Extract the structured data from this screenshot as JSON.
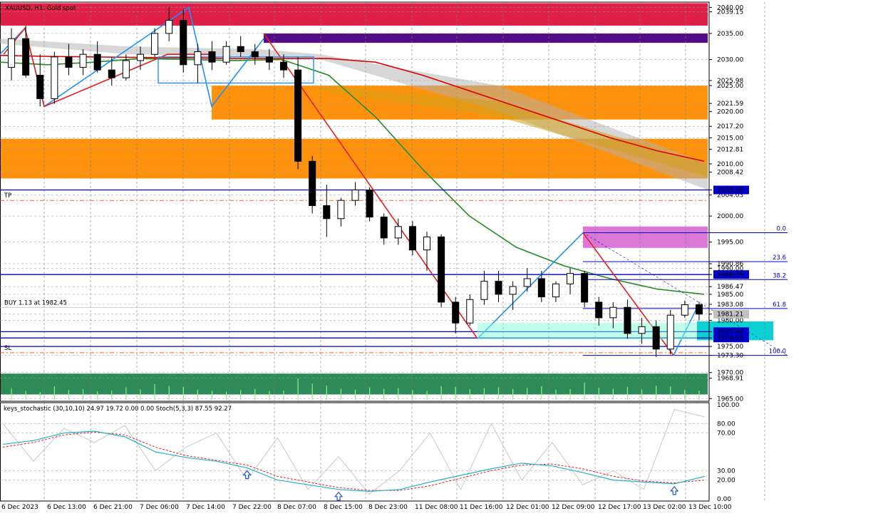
{
  "chart_data": {
    "type": "candlestick",
    "title": "XAUUSD, H1: Gold spot",
    "symbol": "XAUUSD",
    "timeframe": "H1",
    "description": "Gold spot",
    "ylim": [
      1964.5,
      2041.0
    ],
    "y_ticks": [
      "2040.00",
      "2039.15",
      "2035.00",
      "2030.00",
      "2025.98",
      "2025.00",
      "2021.59",
      "2020.00",
      "2017.20",
      "2015.00",
      "2012.81",
      "2010.00",
      "2008.42",
      "2005.00",
      "2004.03",
      "2000.00",
      "1995.00",
      "1990.86",
      "1990.00",
      "1988.79",
      "1986.47",
      "1985.00",
      "1983.08",
      "1981.21",
      "1980.00",
      "1977.84",
      "1976.63",
      "1975.00",
      "1973.30",
      "1970.00",
      "1968.91",
      "1965.00"
    ],
    "x_ticks": [
      "6 Dec 2023",
      "6 Dec 13:00",
      "6 Dec 21:00",
      "7 Dec 06:00",
      "7 Dec 14:00",
      "7 Dec 22:00",
      "8 Dec 07:00",
      "8 Dec 15:00",
      "8 Dec 23:00",
      "11 Dec 08:00",
      "11 Dec 16:00",
      "12 Dec 01:00",
      "12 Dec 09:00",
      "12 Dec 17:00",
      "13 Dec 02:00",
      "13 Dec 10:00"
    ],
    "price_labels": [
      {
        "value": 1981.21,
        "color": "#c0c0c0"
      },
      {
        "value": 1977.84,
        "color": "#0000cc"
      },
      {
        "value": 1976.63,
        "color": "#0000cc"
      },
      {
        "value": 1988.79,
        "color": "#0000cc"
      },
      {
        "value": 2005.0,
        "color": "#0000cc"
      }
    ],
    "zones": [
      {
        "name": "red-supply-zone",
        "y1": 2036.5,
        "y2": 2040.8,
        "color": "#dc143c"
      },
      {
        "name": "purple-zone",
        "y1": 2033.2,
        "y2": 2035.0,
        "color": "#4b0082"
      },
      {
        "name": "orange-zone-upper",
        "y1": 2018.5,
        "y2": 2025.0,
        "color": "#ff8c00"
      },
      {
        "name": "orange-zone-lower",
        "y1": 2007.2,
        "y2": 2014.8,
        "color": "#ff8c00"
      },
      {
        "name": "magenta-zone",
        "y1": 1993.9,
        "y2": 1998.0,
        "color": "#da70d6"
      },
      {
        "name": "cyan-zone",
        "y1": 1976.2,
        "y2": 1979.8,
        "color": "#00ced1"
      },
      {
        "name": "volume-band",
        "y1": 1965.8,
        "y2": 1969.8,
        "color": "#2e8b57"
      }
    ],
    "horizontal_levels": [
      {
        "label": "TP",
        "value": 2003.0,
        "style": "dashdot",
        "color": "#ff4500"
      },
      {
        "label": "SL",
        "value": 1973.8,
        "style": "dashdot",
        "color": "#ff4500"
      },
      {
        "label": "BUY 1.13 at 1982.45",
        "value": 1982.45,
        "style": "solid",
        "color": "#c0c0c0"
      }
    ],
    "fibonacci": {
      "high": 1996.8,
      "low": 1973.3,
      "levels": [
        {
          "label": "0.0",
          "value": 1996.8
        },
        {
          "label": "23.6",
          "value": 1991.25
        },
        {
          "label": "38.2",
          "value": 1987.82
        },
        {
          "label": "61.8",
          "value": 1982.28
        },
        {
          "label": "100.0",
          "value": 1973.3
        }
      ]
    },
    "series": [
      {
        "name": "",
        "color": "#dd0000",
        "values": [
          2030.8,
          2030.6,
          2030.5,
          2030.4,
          2030.3,
          2030.2,
          2030.2,
          2030.2,
          2029.5,
          2027.0,
          2024.0,
          2021.0,
          2018.0,
          2015.0,
          2012.5,
          2010.5
        ]
      },
      {
        "name": "",
        "color": "#228b22",
        "values": [
          2029.5,
          2029.0,
          2029.5,
          2030.2,
          2030.0,
          2029.8,
          2030.0,
          2027.0,
          2019.0,
          2009.0,
          2000.0,
          1994.0,
          1990.5,
          1988.0,
          1986.0,
          1985.0
        ]
      }
    ],
    "candles": [
      [
        2028.5,
        2036.0,
        2026.0,
        2034.0
      ],
      [
        2034.0,
        2036.5,
        2026.5,
        2027.0
      ],
      [
        2027.0,
        2031.0,
        2021.0,
        2022.5
      ],
      [
        2022.5,
        2031.5,
        2021.5,
        2030.5
      ],
      [
        2030.5,
        2033.0,
        2027.0,
        2028.5
      ],
      [
        2028.5,
        2032.0,
        2027.0,
        2031.0
      ],
      [
        2031.0,
        2033.5,
        2027.5,
        2028.0
      ],
      [
        2028.0,
        2030.5,
        2025.0,
        2026.5
      ],
      [
        2026.5,
        2031.0,
        2026.0,
        2029.8
      ],
      [
        2029.8,
        2032.5,
        2028.0,
        2031.0
      ],
      [
        2031.0,
        2036.0,
        2030.5,
        2035.0
      ],
      [
        2035.0,
        2040.0,
        2033.5,
        2037.5
      ],
      [
        2037.5,
        2039.5,
        2027.5,
        2029.0
      ],
      [
        2029.0,
        2033.0,
        2025.5,
        2031.5
      ],
      [
        2031.5,
        2033.5,
        2028.0,
        2029.5
      ],
      [
        2029.5,
        2033.5,
        2029.0,
        2032.5
      ],
      [
        2032.5,
        2034.5,
        2030.5,
        2031.5
      ],
      [
        2031.5,
        2033.0,
        2029.0,
        2030.5
      ],
      [
        2030.5,
        2032.0,
        2028.0,
        2029.5
      ],
      [
        2029.5,
        2031.0,
        2026.5,
        2028.0
      ],
      [
        2028.0,
        2030.5,
        2009.0,
        2010.5
      ],
      [
        2010.5,
        2011.5,
        2000.5,
        2002.0
      ],
      [
        2002.0,
        2006.0,
        1996.0,
        1999.5
      ],
      [
        1999.5,
        2003.5,
        1998.0,
        2003.0
      ],
      [
        2003.0,
        2006.5,
        2002.0,
        2005.0
      ],
      [
        2005.0,
        2005.5,
        1999.0,
        1999.8
      ],
      [
        1999.8,
        2000.5,
        1994.5,
        1995.8
      ],
      [
        1995.8,
        1999.5,
        1994.5,
        1998.0
      ],
      [
        1998.0,
        1999.0,
        1992.5,
        1993.5
      ],
      [
        1993.5,
        1997.0,
        1989.5,
        1996.0
      ],
      [
        1996.0,
        1996.5,
        1982.5,
        1983.5
      ],
      [
        1983.5,
        1984.5,
        1977.5,
        1979.5
      ],
      [
        1979.5,
        1985.0,
        1979.0,
        1984.0
      ],
      [
        1984.0,
        1989.5,
        1983.0,
        1987.5
      ],
      [
        1987.5,
        1989.5,
        1983.5,
        1985.0
      ],
      [
        1985.0,
        1987.5,
        1982.0,
        1986.5
      ],
      [
        1986.5,
        1990.0,
        1985.5,
        1988.0
      ],
      [
        1988.0,
        1989.5,
        1983.5,
        1984.5
      ],
      [
        1984.5,
        1987.5,
        1983.5,
        1987.0
      ],
      [
        1987.0,
        1990.0,
        1985.0,
        1989.0
      ],
      [
        1989.0,
        1989.5,
        1982.5,
        1983.5
      ],
      [
        1983.5,
        1984.5,
        1979.0,
        1980.5
      ],
      [
        1980.5,
        1983.5,
        1978.5,
        1982.5
      ],
      [
        1982.5,
        1984.0,
        1976.5,
        1977.5
      ],
      [
        1977.5,
        1980.5,
        1975.5,
        1978.8
      ],
      [
        1978.8,
        1980.0,
        1973.0,
        1974.5
      ],
      [
        1974.5,
        1982.0,
        1973.5,
        1981.0
      ],
      [
        1981.0,
        1983.8,
        1980.5,
        1983.0
      ],
      [
        1983.0,
        1983.5,
        1980.0,
        1981.2
      ]
    ],
    "volume": [
      52,
      40,
      35,
      60,
      44,
      48,
      38,
      42,
      55,
      47,
      70,
      62,
      58,
      45,
      40,
      36,
      43,
      48,
      39,
      41,
      95,
      72,
      64,
      50,
      45,
      55,
      49,
      52,
      44,
      40,
      61,
      58,
      47,
      52,
      56,
      49,
      53,
      60,
      45,
      48,
      77,
      54,
      50,
      58,
      46,
      63,
      59,
      44,
      41
    ],
    "oscillator": {
      "title": "keys_stochastic (30,10,10) 24.97 19.72 0.00 0.00 Stoch(5,3,3) 87.55 92.27",
      "ylim": [
        0,
        100
      ],
      "y_ticks": [
        "100.00",
        "80.00",
        "70.00",
        "30.00",
        "20.00",
        "0.00"
      ],
      "main": [
        58,
        62,
        70,
        72,
        66,
        50,
        44,
        40,
        33,
        20,
        15,
        10,
        8,
        10,
        18,
        25,
        32,
        38,
        35,
        28,
        20,
        18,
        16,
        24
      ],
      "signal": [
        55,
        60,
        68,
        71,
        68,
        55,
        46,
        41,
        36,
        24,
        18,
        12,
        9,
        9,
        14,
        22,
        30,
        36,
        37,
        32,
        24,
        19,
        17,
        20
      ],
      "fast": [
        80,
        40,
        75,
        60,
        78,
        30,
        55,
        70,
        20,
        65,
        10,
        45,
        5,
        30,
        70,
        10,
        80,
        20,
        60,
        15,
        30,
        10,
        95,
        87
      ],
      "buy_arrows": [
        8,
        11,
        22
      ]
    }
  }
}
